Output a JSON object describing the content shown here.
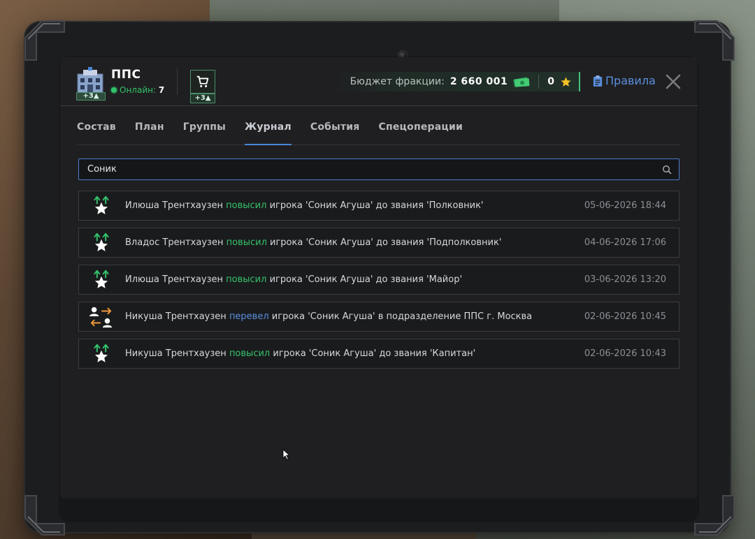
{
  "header": {
    "faction_name": "ППС",
    "faction_badge": "+3▲",
    "online_label": "Онлайн:",
    "online_count": "7",
    "cart_badge": "+3▲",
    "budget_label": "Бюджет фракции:",
    "budget_value": "2 660 001",
    "stars_value": "0",
    "rules_label": "Правила"
  },
  "tabs": [
    {
      "label": "Состав",
      "active": false
    },
    {
      "label": "План",
      "active": false
    },
    {
      "label": "Группы",
      "active": false
    },
    {
      "label": "Журнал",
      "active": true
    },
    {
      "label": "События",
      "active": false
    },
    {
      "label": "Спецоперации",
      "active": false
    }
  ],
  "search": {
    "value": "Соник",
    "placeholder": ""
  },
  "log": [
    {
      "icon": "promote-star-icon",
      "actor": "Илюша Трентхаузен",
      "action": "повысил",
      "action_color": "green",
      "rest": "игрока 'Соник Агуша' до звания 'Полковник'",
      "date": "05-06-2026 18:44"
    },
    {
      "icon": "promote-star-icon",
      "actor": "Владос Трентхаузен",
      "action": "повысил",
      "action_color": "green",
      "rest": "игрока 'Соник Агуша' до звания 'Подполковник'",
      "date": "04-06-2026 17:06"
    },
    {
      "icon": "promote-star-icon",
      "actor": "Илюша Трентхаузен",
      "action": "повысил",
      "action_color": "green",
      "rest": "игрока 'Соник Агуша' до звания 'Майор'",
      "date": "03-06-2026 13:20"
    },
    {
      "icon": "transfer-users-icon",
      "actor": "Никуша Трентхаузен",
      "action": "перевел",
      "action_color": "blue",
      "rest": "игрока 'Соник Агуша' в подразделение ППС г. Москва",
      "date": "02-06-2026 10:45"
    },
    {
      "icon": "promote-star-icon",
      "actor": "Никуша Трентхаузен",
      "action": "повысил",
      "action_color": "green",
      "rest": "игрока 'Соник Агуша' до звания 'Капитан'",
      "date": "02-06-2026 10:43"
    }
  ],
  "colors": {
    "accent_blue": "#4a86d9",
    "action_green": "#35c26b",
    "action_blue": "#5b8fde",
    "panel_bg": "#1f1f21"
  }
}
